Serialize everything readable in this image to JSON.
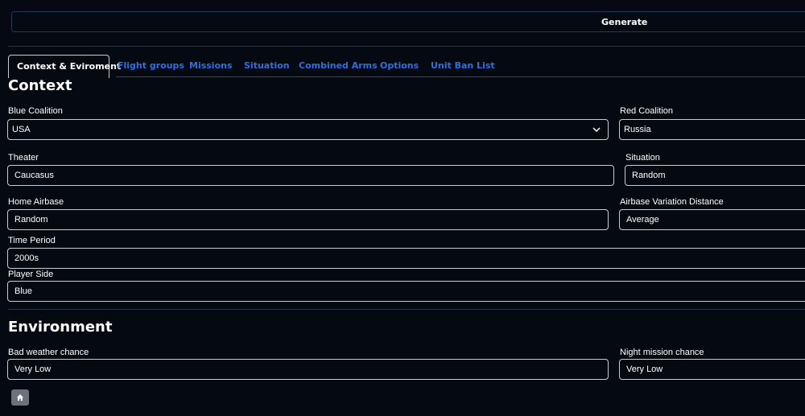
{
  "generate_label": "Generate",
  "tabs": [
    {
      "label": "Context & Eviroment"
    },
    {
      "label": "Flight groups"
    },
    {
      "label": "Missions"
    },
    {
      "label": "Situation"
    },
    {
      "label": "Combined Arms"
    },
    {
      "label": "Options"
    },
    {
      "label": "Unit Ban List"
    }
  ],
  "context": {
    "title": "Context",
    "blue_coalition": {
      "label": "Blue Coalition",
      "value": "USA"
    },
    "red_coalition": {
      "label": "Red Coalition",
      "value": "Russia"
    },
    "theater": {
      "label": "Theater",
      "value": "Caucasus"
    },
    "situation": {
      "label": "Situation",
      "value": "Random"
    },
    "home_airbase": {
      "label": "Home Airbase",
      "value": "Random"
    },
    "airbase_variation": {
      "label": "Airbase Variation Distance",
      "value": "Average"
    },
    "time_period": {
      "label": "Time Period",
      "value": "2000s"
    },
    "player_side": {
      "label": "Player Side",
      "value": "Blue"
    }
  },
  "environment": {
    "title": "Environment",
    "bad_weather": {
      "label": "Bad weather chance",
      "value": "Very Low"
    },
    "night_mission": {
      "label": "Night mission chance",
      "value": "Very Low"
    }
  },
  "colors": {
    "background": "#050a12",
    "tab_link": "#2f6fe0",
    "home_button": "#6d727a"
  },
  "icons": {
    "chevron": "chevron-down-icon",
    "home": "home-icon"
  }
}
